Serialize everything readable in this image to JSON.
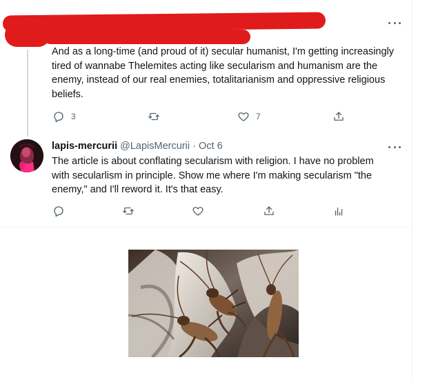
{
  "colors": {
    "redaction": "#e01b1b",
    "text": "#0f1419",
    "muted": "#536471",
    "thread_line": "#cfd9de",
    "divider": "#eff3f4"
  },
  "parent_tweet": {
    "text": "And as a long-time (and proud of it) secular humanist, I'm getting increasingly tired of wannabe Thelemites acting like secularism and humanism are the enemy, instead of our real enemies, totalitarianism and oppressive religious beliefs.",
    "actions": {
      "reply_count": "3",
      "retweet_count": "",
      "like_count": "7",
      "reply_icon": "reply-icon",
      "retweet_icon": "retweet-icon",
      "like_icon": "like-icon",
      "share_icon": "share-icon"
    },
    "more_icon": "more-icon"
  },
  "reply_tweet": {
    "display_name": "lapis-mercurii",
    "handle": "@LapisMercurii",
    "separator": "·",
    "date": "Oct 6",
    "text": "The article is about conflating secularism with religion. I have no problem with secularlism in principle. Show me where I'm making secularism \"the enemy,\" and I'll reword it. It's that easy.",
    "actions": {
      "reply_icon": "reply-icon",
      "retweet_icon": "retweet-icon",
      "like_icon": "like-icon",
      "share_icon": "share-icon",
      "analytics_icon": "analytics-icon"
    },
    "more_icon": "more-icon"
  },
  "attached_image": {
    "subject": "crickets on dried leaves"
  }
}
